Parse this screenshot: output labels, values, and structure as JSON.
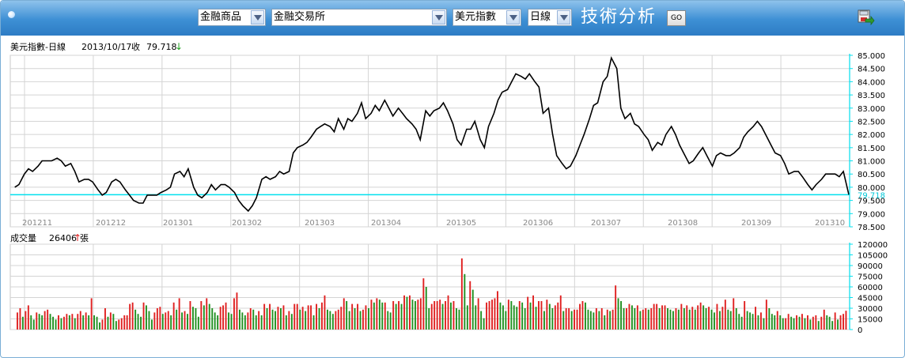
{
  "toolbar": {
    "category_select": "金融商品",
    "exchange_select": "金融交易所",
    "instrument_select": "美元指數",
    "period_select": "日線",
    "title": "技術分析",
    "go_label": "GO",
    "export_icon": "save-export-icon",
    "accent_color": "#2d7cc4"
  },
  "price_panel": {
    "legend_name": "美元指數-日線",
    "legend_date": "2013/10/17",
    "legend_close_label": "收",
    "legend_close_value": "79.718",
    "legend_arrow": "↓",
    "current_value_label": "79.718"
  },
  "volume_panel": {
    "legend_name": "成交量",
    "legend_value": "26406",
    "legend_arrow": "↑",
    "legend_unit": "張"
  },
  "chart_data": [
    {
      "type": "line",
      "ylim": [
        78.5,
        85.0
      ],
      "yticks": [
        "85.000",
        "84.500",
        "84.000",
        "83.500",
        "83.000",
        "82.500",
        "82.000",
        "81.500",
        "81.000",
        "80.500",
        "80.000",
        "79.500",
        "79.000",
        "78.500"
      ],
      "x_tick_labels": [
        "201211",
        "201212",
        "201301",
        "201302",
        "201303",
        "201304",
        "201305",
        "201306",
        "201307",
        "201308",
        "201309",
        "201310"
      ],
      "current_value": 79.718,
      "colors": {
        "line": "#000000",
        "current_line": "#00e0ee",
        "grid": "#c8c8c8"
      },
      "points": [
        [
          1,
          80.0
        ],
        [
          4,
          80.1
        ],
        [
          8,
          80.5
        ],
        [
          11,
          80.7
        ],
        [
          14,
          80.6
        ],
        [
          18,
          80.8
        ],
        [
          21,
          81.0
        ],
        [
          25,
          81.0
        ],
        [
          28,
          81.0
        ],
        [
          32,
          81.1
        ],
        [
          35,
          81.0
        ],
        [
          38,
          80.8
        ],
        [
          42,
          80.9
        ],
        [
          45,
          80.6
        ],
        [
          48,
          80.2
        ],
        [
          52,
          80.3
        ],
        [
          55,
          80.3
        ],
        [
          58,
          80.2
        ],
        [
          62,
          79.9
        ],
        [
          65,
          79.7
        ],
        [
          68,
          79.8
        ],
        [
          72,
          80.2
        ],
        [
          75,
          80.3
        ],
        [
          78,
          80.2
        ],
        [
          82,
          79.9
        ],
        [
          85,
          79.7
        ],
        [
          88,
          79.5
        ],
        [
          92,
          79.4
        ],
        [
          95,
          79.4
        ],
        [
          98,
          79.7
        ],
        [
          102,
          79.7
        ],
        [
          105,
          79.7
        ],
        [
          108,
          79.8
        ],
        [
          112,
          79.9
        ],
        [
          115,
          80.0
        ],
        [
          118,
          80.5
        ],
        [
          122,
          80.6
        ],
        [
          125,
          80.4
        ],
        [
          128,
          80.7
        ],
        [
          132,
          80.0
        ],
        [
          135,
          79.7
        ],
        [
          138,
          79.6
        ],
        [
          142,
          79.8
        ],
        [
          145,
          80.1
        ],
        [
          148,
          79.9
        ],
        [
          152,
          80.1
        ],
        [
          155,
          80.1
        ],
        [
          158,
          80.0
        ],
        [
          162,
          79.8
        ],
        [
          165,
          79.5
        ],
        [
          168,
          79.3
        ],
        [
          172,
          79.1
        ],
        [
          175,
          79.3
        ],
        [
          178,
          79.6
        ],
        [
          182,
          80.3
        ],
        [
          185,
          80.4
        ],
        [
          188,
          80.3
        ],
        [
          192,
          80.4
        ],
        [
          195,
          80.6
        ],
        [
          198,
          80.5
        ],
        [
          202,
          80.6
        ],
        [
          205,
          81.3
        ],
        [
          208,
          81.5
        ],
        [
          212,
          81.6
        ],
        [
          215,
          81.7
        ],
        [
          218,
          81.9
        ],
        [
          222,
          82.2
        ],
        [
          225,
          82.3
        ],
        [
          228,
          82.4
        ],
        [
          232,
          82.3
        ],
        [
          235,
          82.1
        ],
        [
          238,
          82.6
        ],
        [
          242,
          82.2
        ],
        [
          245,
          82.6
        ],
        [
          248,
          82.5
        ],
        [
          252,
          82.8
        ],
        [
          255,
          83.2
        ],
        [
          258,
          82.6
        ],
        [
          262,
          82.8
        ],
        [
          265,
          83.1
        ],
        [
          268,
          82.9
        ],
        [
          272,
          83.3
        ],
        [
          275,
          83.0
        ],
        [
          278,
          82.7
        ],
        [
          282,
          83.0
        ],
        [
          285,
          82.8
        ],
        [
          288,
          82.6
        ],
        [
          292,
          82.4
        ],
        [
          295,
          82.2
        ],
        [
          298,
          81.8
        ],
        [
          302,
          82.9
        ],
        [
          305,
          82.7
        ],
        [
          308,
          82.9
        ],
        [
          312,
          83.0
        ],
        [
          315,
          83.2
        ],
        [
          318,
          82.9
        ],
        [
          322,
          82.4
        ],
        [
          325,
          81.8
        ],
        [
          328,
          81.6
        ],
        [
          332,
          82.2
        ],
        [
          335,
          82.2
        ],
        [
          338,
          82.5
        ],
        [
          342,
          81.8
        ],
        [
          345,
          81.5
        ],
        [
          348,
          82.3
        ],
        [
          352,
          82.8
        ],
        [
          355,
          83.3
        ],
        [
          358,
          83.6
        ],
        [
          362,
          83.7
        ],
        [
          365,
          84.0
        ],
        [
          368,
          84.3
        ],
        [
          372,
          84.2
        ],
        [
          375,
          84.1
        ],
        [
          378,
          84.3
        ],
        [
          382,
          84.0
        ],
        [
          385,
          83.8
        ],
        [
          388,
          82.8
        ],
        [
          392,
          83.0
        ],
        [
          395,
          82.0
        ],
        [
          398,
          81.2
        ],
        [
          402,
          80.9
        ],
        [
          405,
          80.7
        ],
        [
          408,
          80.8
        ],
        [
          412,
          81.2
        ],
        [
          415,
          81.6
        ],
        [
          418,
          82.0
        ],
        [
          422,
          82.6
        ],
        [
          425,
          83.1
        ],
        [
          428,
          83.2
        ],
        [
          432,
          84.0
        ],
        [
          435,
          84.2
        ],
        [
          438,
          84.9
        ],
        [
          442,
          84.5
        ],
        [
          445,
          83.0
        ],
        [
          448,
          82.6
        ],
        [
          452,
          82.8
        ],
        [
          455,
          82.4
        ],
        [
          458,
          82.3
        ],
        [
          462,
          82.0
        ],
        [
          465,
          81.8
        ],
        [
          468,
          81.4
        ],
        [
          472,
          81.7
        ],
        [
          475,
          81.6
        ],
        [
          478,
          82.0
        ],
        [
          482,
          82.3
        ],
        [
          485,
          82.0
        ],
        [
          488,
          81.6
        ],
        [
          492,
          81.2
        ],
        [
          495,
          80.9
        ],
        [
          498,
          81.0
        ],
        [
          502,
          81.3
        ],
        [
          505,
          81.5
        ],
        [
          508,
          81.2
        ],
        [
          512,
          80.8
        ],
        [
          515,
          81.2
        ],
        [
          518,
          81.3
        ],
        [
          522,
          81.2
        ],
        [
          525,
          81.2
        ],
        [
          528,
          81.3
        ],
        [
          532,
          81.5
        ],
        [
          535,
          81.9
        ],
        [
          538,
          82.1
        ],
        [
          542,
          82.3
        ],
        [
          545,
          82.5
        ],
        [
          548,
          82.3
        ],
        [
          552,
          81.9
        ],
        [
          555,
          81.6
        ],
        [
          558,
          81.3
        ],
        [
          562,
          81.2
        ],
        [
          565,
          80.9
        ],
        [
          568,
          80.5
        ],
        [
          572,
          80.6
        ],
        [
          575,
          80.6
        ],
        [
          578,
          80.4
        ],
        [
          582,
          80.1
        ],
        [
          585,
          79.9
        ],
        [
          588,
          80.1
        ],
        [
          592,
          80.3
        ],
        [
          595,
          80.5
        ],
        [
          598,
          80.5
        ],
        [
          602,
          80.5
        ],
        [
          605,
          80.4
        ],
        [
          608,
          80.6
        ],
        [
          612,
          79.718
        ]
      ]
    },
    {
      "type": "bar",
      "ylim": [
        0,
        120000
      ],
      "yticks": [
        "120000",
        "105000",
        "90000",
        "75000",
        "60000",
        "45000",
        "30000",
        "15000",
        "0"
      ],
      "colors": {
        "up": "#e02020",
        "down": "#209020",
        "grid": "#c8c8c8"
      },
      "values": [
        24000,
        30000,
        18000,
        26000,
        34000,
        20000,
        14000,
        24000,
        22000,
        20000,
        26000,
        28000,
        22000,
        18000,
        14000,
        20000,
        16000,
        18000,
        22000,
        20000,
        22000,
        16000,
        22000,
        26000,
        20000,
        24000,
        20000,
        44000,
        20000,
        18000,
        10000,
        14000,
        30000,
        18000,
        24000,
        22000,
        12000,
        14000,
        16000,
        20000,
        20000,
        36000,
        38000,
        28000,
        22000,
        18000,
        38000,
        34000,
        26000,
        14000,
        24000,
        30000,
        32000,
        22000,
        24000,
        26000,
        20000,
        38000,
        28000,
        44000,
        24000,
        26000,
        22000,
        40000,
        32000,
        30000,
        18000,
        40000,
        34000,
        44000,
        36000,
        30000,
        24000,
        20000,
        32000,
        34000,
        38000,
        24000,
        22000,
        44000,
        52000,
        28000,
        24000,
        20000,
        24000,
        30000,
        28000,
        20000,
        26000,
        20000,
        36000,
        30000,
        36000,
        28000,
        26000,
        32000,
        30000,
        34000,
        20000,
        26000,
        22000,
        36000,
        36000,
        28000,
        32000,
        26000,
        34000,
        34000,
        20000,
        36000,
        30000,
        38000,
        48000,
        28000,
        26000,
        22000,
        26000,
        28000,
        32000,
        44000,
        40000,
        26000,
        36000,
        30000,
        36000,
        26000,
        28000,
        34000,
        30000,
        42000,
        38000,
        44000,
        42000,
        38000,
        38000,
        26000,
        24000,
        40000,
        36000,
        40000,
        36000,
        48000,
        46000,
        48000,
        42000,
        40000,
        42000,
        44000,
        72000,
        60000,
        30000,
        36000,
        40000,
        40000,
        42000,
        36000,
        40000,
        48000,
        38000,
        40000,
        30000,
        28000,
        100000,
        78000,
        34000,
        68000,
        56000,
        34000,
        44000,
        26000,
        16000,
        38000,
        40000,
        42000,
        44000,
        54000,
        38000,
        34000,
        26000,
        42000,
        40000,
        34000,
        32000,
        40000,
        38000,
        30000,
        46000,
        38000,
        48000,
        32000,
        40000,
        40000,
        26000,
        42000,
        36000,
        30000,
        34000,
        38000,
        48000,
        26000,
        30000,
        30000,
        26000,
        28000,
        28000,
        36000,
        40000,
        38000,
        28000,
        26000,
        24000,
        30000,
        26000,
        30000,
        20000,
        28000,
        26000,
        28000,
        62000,
        44000,
        40000,
        30000,
        30000,
        36000,
        34000,
        30000,
        34000,
        26000,
        28000,
        30000,
        28000,
        30000,
        36000,
        36000,
        30000,
        34000,
        34000,
        30000,
        28000,
        26000,
        30000,
        28000,
        36000,
        30000,
        34000,
        28000,
        32000,
        28000,
        34000,
        38000,
        34000,
        30000,
        32000,
        28000,
        24000,
        36000,
        26000,
        32000,
        42000,
        28000,
        26000,
        44000,
        30000,
        22000,
        18000,
        40000,
        26000,
        24000,
        22000,
        32000,
        20000,
        24000,
        16000,
        42000,
        30000,
        22000,
        20000,
        26000,
        20000,
        16000,
        16000,
        22000,
        18000,
        16000,
        20000,
        18000,
        22000,
        16000,
        20000,
        14000,
        18000,
        20000,
        12000,
        18000,
        28000,
        20000,
        18000,
        12000,
        24000,
        14000,
        20000,
        22000,
        26406
      ]
    }
  ]
}
